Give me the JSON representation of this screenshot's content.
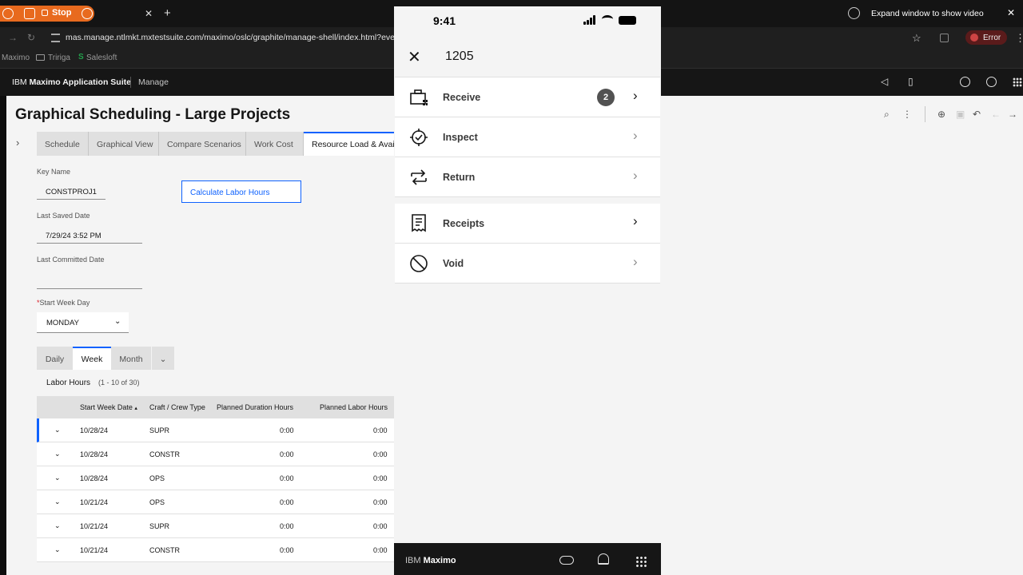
{
  "browser": {
    "recorder": {
      "stop_label": "Stop"
    },
    "tab_close": "✕",
    "tab_add": "+",
    "url": "mas.manage.ntlmkt.mxtestsuite.com/maximo/oslc/graphite/manage-shell/index.html?event",
    "error_label": "Error",
    "bookmarks": [
      "Maximo",
      "Tririga",
      "Salesloft"
    ]
  },
  "video_notice": {
    "text": "Expand window to show video",
    "close": "✕"
  },
  "maximo_header": {
    "brand_prefix": "IBM",
    "brand_name": "Maximo Application Suite",
    "app": "Manage"
  },
  "page": {
    "title": "Graphical Scheduling - Large Projects",
    "tabs": [
      {
        "label": "Schedule"
      },
      {
        "label": "Graphical View"
      },
      {
        "label": "Compare Scenarios"
      },
      {
        "label": "Work Cost"
      },
      {
        "label": "Resource Load & Avail"
      }
    ],
    "fields": {
      "key_name": {
        "label": "Key Name",
        "value": "CONSTPROJ1"
      },
      "last_saved": {
        "label": "Last Saved Date",
        "value": "7/29/24 3:52 PM"
      },
      "last_committed": {
        "label": "Last Committed Date",
        "value": ""
      },
      "start_week_day": {
        "required": "*",
        "label": "Start Week Day",
        "value": "MONDAY"
      }
    },
    "calculate_button": "Calculate Labor Hours",
    "segments": [
      {
        "label": "Daily"
      },
      {
        "label": "Week"
      },
      {
        "label": "Month"
      }
    ],
    "table": {
      "title": "Labor Hours",
      "count": "(1 - 10 of 30)",
      "columns": [
        "Start Week Date",
        "Craft / Crew Type",
        "Planned Duration Hours",
        "Planned Labor Hours"
      ],
      "sort_indicator": "▴",
      "rows": [
        {
          "date": "10/28/24",
          "craft": "SUPR",
          "duration": "0:00",
          "labor": "0:00"
        },
        {
          "date": "10/28/24",
          "craft": "CONSTR",
          "duration": "0:00",
          "labor": "0:00"
        },
        {
          "date": "10/28/24",
          "craft": "OPS",
          "duration": "0:00",
          "labor": "0:00"
        },
        {
          "date": "10/21/24",
          "craft": "OPS",
          "duration": "0:00",
          "labor": "0:00"
        },
        {
          "date": "10/21/24",
          "craft": "SUPR",
          "duration": "0:00",
          "labor": "0:00"
        },
        {
          "date": "10/21/24",
          "craft": "CONSTR",
          "duration": "0:00",
          "labor": "0:00"
        }
      ]
    }
  },
  "phone": {
    "time": "9:41",
    "close": "✕",
    "title": "1205",
    "menu": [
      {
        "label": "Receive",
        "icon": "receive-icon",
        "badge": "2"
      },
      {
        "label": "Inspect",
        "icon": "inspect-icon"
      },
      {
        "label": "Return",
        "icon": "return-icon"
      },
      {
        "label": "Receipts",
        "icon": "receipts-icon"
      },
      {
        "label": "Void",
        "icon": "void-icon"
      }
    ],
    "footer": {
      "brand_prefix": "IBM",
      "brand_name": "Maximo"
    }
  },
  "colors": {
    "accent": "#0f62fe",
    "recorder": "#e86a1e",
    "header": "#161616"
  }
}
